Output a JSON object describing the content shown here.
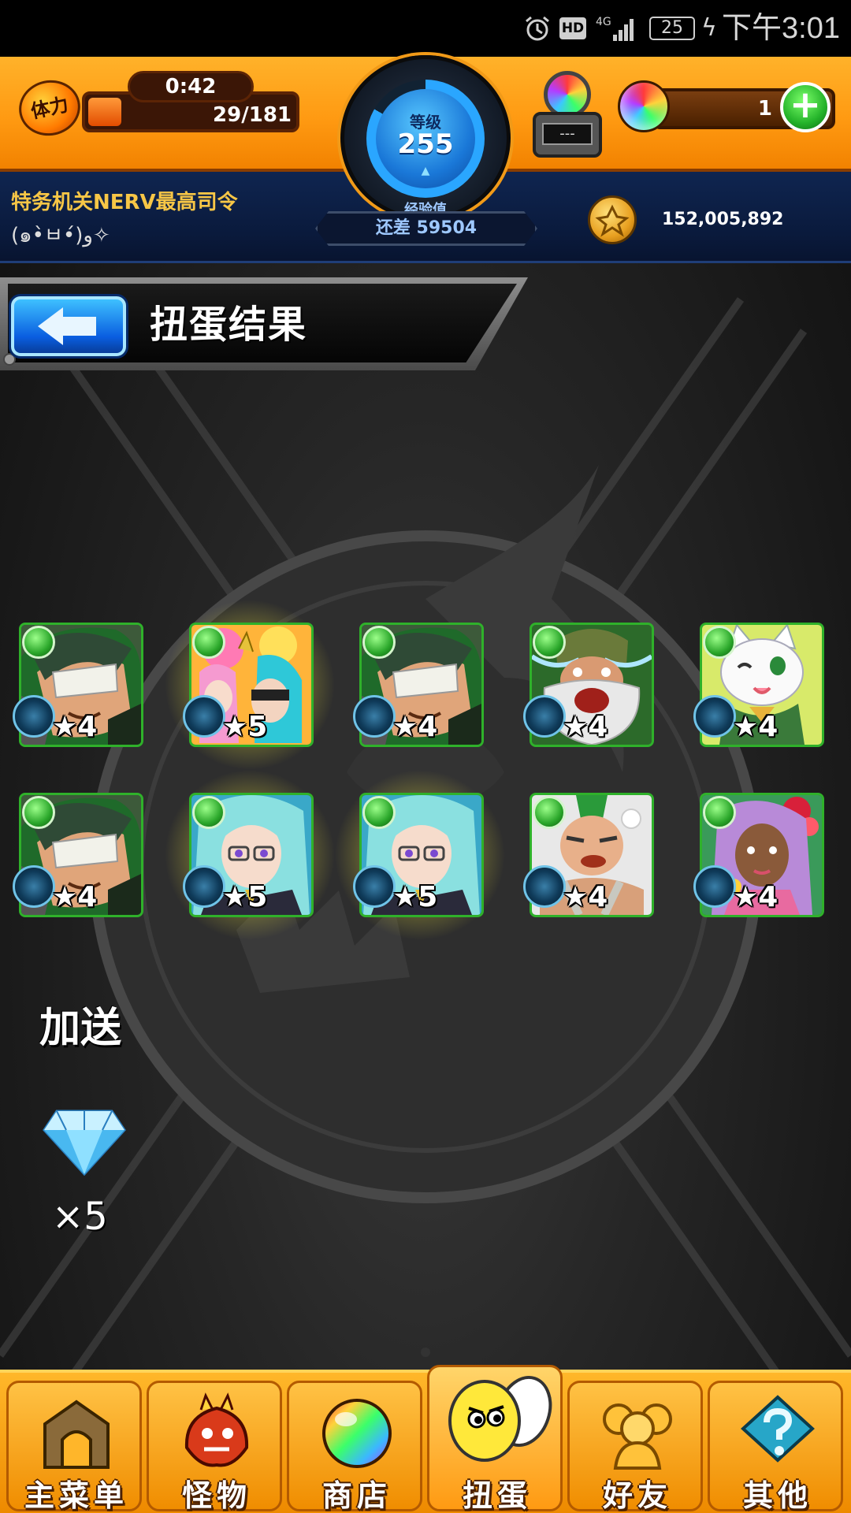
{
  "status_bar": {
    "icons": [
      "alarm-icon",
      "hd-icon",
      "signal-4g-icon",
      "battery-icon",
      "charging-icon"
    ],
    "network": "4G",
    "hd_label": "HD",
    "battery_level": "25",
    "time": "下午3:01"
  },
  "header": {
    "stamina": {
      "icon_label": "体力",
      "timer": "0:42",
      "current": 29,
      "max": 181,
      "display": "29/181"
    },
    "level": {
      "label": "等级",
      "value": "255",
      "exp_label": "经验值",
      "exp_remaining": "还差 59504"
    },
    "orb_machine_label": "---",
    "orbs": {
      "count": "1",
      "add_label": "+"
    },
    "player": {
      "name": "特务机关NERV最高司令",
      "subtitle": "(๑•̀ㅂ•́)و✧"
    },
    "coins": "152,005,892"
  },
  "screen": {
    "title": "扭蛋结果"
  },
  "results": [
    {
      "character": "bandaged-swordsman",
      "stars": "★4",
      "rarity": 4,
      "glow": false
    },
    {
      "character": "party-girls",
      "stars": "★5",
      "rarity": 5,
      "glow": true
    },
    {
      "character": "bandaged-swordsman",
      "stars": "★4",
      "rarity": 4,
      "glow": false
    },
    {
      "character": "bearded-elder",
      "stars": "★4",
      "rarity": 4,
      "glow": false
    },
    {
      "character": "white-cat",
      "stars": "★4",
      "rarity": 4,
      "glow": false
    },
    {
      "character": "bandaged-swordsman",
      "stars": "★4",
      "rarity": 4,
      "glow": false
    },
    {
      "character": "glasses-girl",
      "stars": "★5",
      "rarity": 5,
      "glow": true
    },
    {
      "character": "glasses-girl",
      "stars": "★5",
      "rarity": 5,
      "glow": true
    },
    {
      "character": "mohawk-brawler",
      "stars": "★4",
      "rarity": 4,
      "glow": false
    },
    {
      "character": "flower-dancer",
      "stars": "★4",
      "rarity": 4,
      "glow": false
    }
  ],
  "bonus": {
    "label": "加送",
    "item_icon": "diamond-icon",
    "quantity": "×5"
  },
  "nav": [
    {
      "label": "主菜单",
      "icon": "castle-gate-icon"
    },
    {
      "label": "怪物",
      "icon": "monster-icon"
    },
    {
      "label": "商店",
      "icon": "rainbow-orb-icon"
    },
    {
      "label": "扭蛋",
      "icon": "egg-icon",
      "active": true
    },
    {
      "label": "好友",
      "icon": "friends-icon"
    },
    {
      "label": "其他",
      "icon": "question-icon"
    }
  ],
  "colors": {
    "header_orange": "#ff9a12",
    "header_navy": "#0a1a3c",
    "player_name": "#f7c646",
    "element_green": "#2aa62a",
    "glow_yellow": "#f0e63c",
    "back_button_blue": "#0a5ee0"
  }
}
